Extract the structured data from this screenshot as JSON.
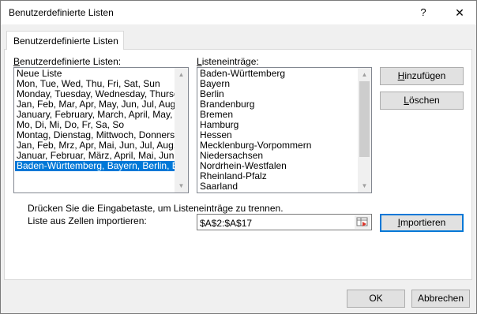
{
  "window": {
    "title": "Benutzerdefinierte Listen",
    "help_glyph": "?",
    "close_glyph": "✕"
  },
  "tab": {
    "label": "Benutzerdefinierte Listen"
  },
  "custom_lists": {
    "label_prefix": "B",
    "label_rest": "enutzerdefinierte Listen:",
    "items": [
      "Neue Liste",
      "Mon, Tue, Wed, Thu, Fri, Sat, Sun",
      "Monday, Tuesday, Wednesday, Thursday",
      "Jan, Feb, Mar, Apr, May, Jun, Jul, Aug, Se",
      "January, February, March, April, May, Ju",
      "Mo, Di, Mi, Do, Fr, Sa, So",
      "Montag, Dienstag, Mittwoch, Donnerstag",
      "Jan, Feb, Mrz, Apr, Mai, Jun, Jul, Aug, Se",
      "Januar, Februar, März, April, Mai, Juni, Ju",
      "Baden-Württemberg, Bayern, Berlin, Bra"
    ],
    "selected_index": 9
  },
  "list_entries": {
    "label_prefix": "L",
    "label_rest": "isteneinträge:",
    "items": [
      "Baden-Württemberg",
      "Bayern",
      "Berlin",
      "Brandenburg",
      "Bremen",
      "Hamburg",
      "Hessen",
      "Mecklenburg-Vorpommern",
      "Niedersachsen",
      "Nordrhein-Westfalen",
      "Rheinland-Pfalz",
      "Saarland"
    ]
  },
  "buttons": {
    "add_prefix": "H",
    "add_rest": "inzufügen",
    "delete_prefix": "L",
    "delete_rest": "öschen",
    "import_prefix": "I",
    "import_rest": "mportieren",
    "ok": "OK",
    "cancel": "Abbrechen"
  },
  "hint_text": "Drücken Sie die Eingabetaste, um Listeneinträge zu trennen.",
  "import": {
    "label": "Liste aus Zellen importieren:",
    "value": "$A$2:$A$17"
  },
  "scroll": {
    "left_thumb_fraction": 0.0,
    "right_thumb_fraction": 0.0
  }
}
